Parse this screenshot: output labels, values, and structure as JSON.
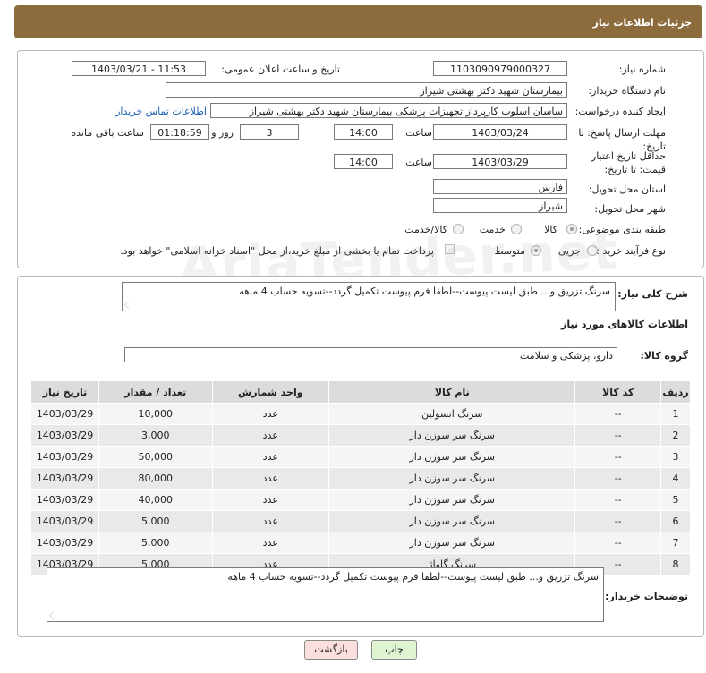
{
  "header": {
    "title": "جزئیات اطلاعات نیاز"
  },
  "form": {
    "need_number_label": "شماره نیاز:",
    "need_number": "1103090979000327",
    "announce_label": "تاریخ و ساعت اعلان عمومی:",
    "announce_value": "1403/03/21 - 11:53",
    "buyer_org_label": "نام دستگاه خریدار:",
    "buyer_org": "بیمارستان شهید دکتر بهشتی شیراز",
    "requester_label": "ایجاد کننده درخواست:",
    "requester": "ساسان اسلوب کارپرداز  تجهیزات پزشکی بیمارستان شهید دکتر بهشتی شیراز",
    "contact_link": "اطلاعات تماس خریدار",
    "deadline_label": "مهلت ارسال پاسخ: تا تاریخ:",
    "deadline_date": "1403/03/24",
    "time_label": "ساعت",
    "deadline_time": "14:00",
    "days_value": "3",
    "days_label": "روز و",
    "remaining_time": "01:18:59",
    "remaining_label": "ساعت باقی مانده",
    "validity_label": "حداقل تاریخ اعتبار قیمت: تا تاریخ:",
    "validity_date": "1403/03/29",
    "validity_time": "14:00",
    "province_label": "استان محل تحویل:",
    "province": "فارس",
    "city_label": "شهر محل تحویل:",
    "city": "شیراز",
    "category_label": "طبقه بندی موضوعی:",
    "category_options": [
      "کالا",
      "خدمت",
      "کالا/خدمت"
    ],
    "process_label": "نوع فرآیند خرید :",
    "process_options": [
      "جزیی",
      "متوسط"
    ],
    "payment_note": "پرداخت تمام یا بخشی از مبلغ خرید،از محل \"اسناد خزانه اسلامی\" خواهد بود."
  },
  "general": {
    "description_label": "شرح کلی نیاز:",
    "description": "سرنگ تزریق و... طبق لیست پیوست--لطفا فرم پیوست تکمیل گردد--تسویه حساب 4 ماهه",
    "section_title": "اطلاعات کالاهای مورد نیاز",
    "goods_group_label": "گروه کالا:",
    "goods_group": "دارو، پزشکی و سلامت"
  },
  "table": {
    "headers": [
      "ردیف",
      "کد کالا",
      "نام کالا",
      "واحد شمارش",
      "تعداد / مقدار",
      "تاریخ نیاز"
    ],
    "rows": [
      [
        "1",
        "--",
        "سرنگ انسولین",
        "عدد",
        "10,000",
        "1403/03/29"
      ],
      [
        "2",
        "--",
        "سرنگ سر سوزن دار",
        "عدد",
        "3,000",
        "1403/03/29"
      ],
      [
        "3",
        "--",
        "سرنگ سر سوزن دار",
        "عدد",
        "50,000",
        "1403/03/29"
      ],
      [
        "4",
        "--",
        "سرنگ سر سوزن دار",
        "عدد",
        "80,000",
        "1403/03/29"
      ],
      [
        "5",
        "--",
        "سرنگ سر سوزن دار",
        "عدد",
        "40,000",
        "1403/03/29"
      ],
      [
        "6",
        "--",
        "سرنگ سر سوزن دار",
        "عدد",
        "5,000",
        "1403/03/29"
      ],
      [
        "7",
        "--",
        "سرنگ سر سوزن دار",
        "عدد",
        "5,000",
        "1403/03/29"
      ],
      [
        "8",
        "--",
        "سرنگ گاواژ",
        "عدد",
        "5,000",
        "1403/03/29"
      ]
    ]
  },
  "buyer_notes": {
    "label": "توضیحات خریدار:",
    "text": "سرنگ تزریق و... طبق لیست پیوست--لطفا فرم پیوست تکمیل گردد--تسویه حساب 4 ماهه"
  },
  "buttons": {
    "print": "چاپ",
    "back": "بازگشت"
  },
  "watermark": "AriaTender.net",
  "colors": {
    "header_bg": "#8c6c3c",
    "print_btn": "#dff5d2",
    "back_btn": "#fbdede",
    "link": "#1a5fb4"
  }
}
